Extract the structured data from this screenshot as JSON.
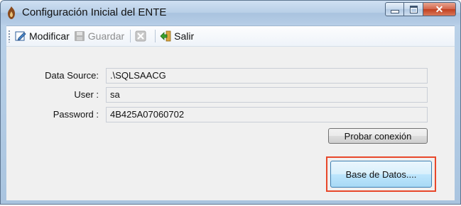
{
  "window": {
    "title": "Configuración Inicial del ENTE",
    "icon": "app-icon",
    "caption_buttons": {
      "minimize": "minimize-icon",
      "maximize": "maximize-icon",
      "close": "close-icon"
    }
  },
  "toolbar": {
    "modificar_label": "Modificar",
    "guardar_label": "Guardar",
    "salir_label": "Salir",
    "icons": [
      "edit-icon",
      "save-icon",
      "delete-icon",
      "exit-icon"
    ]
  },
  "form": {
    "data_source": {
      "label": "Data Source:",
      "value": ".\\SQLSAACG"
    },
    "user": {
      "label": "User :",
      "value": "sa"
    },
    "password": {
      "label": "Password :",
      "value": "4B425A07060702"
    }
  },
  "buttons": {
    "probar_label": "Probar conexión",
    "base_datos_label": "Base de Datos...."
  },
  "colors": {
    "highlight": "#e8472a",
    "title_bar": "#b8cfe7"
  }
}
